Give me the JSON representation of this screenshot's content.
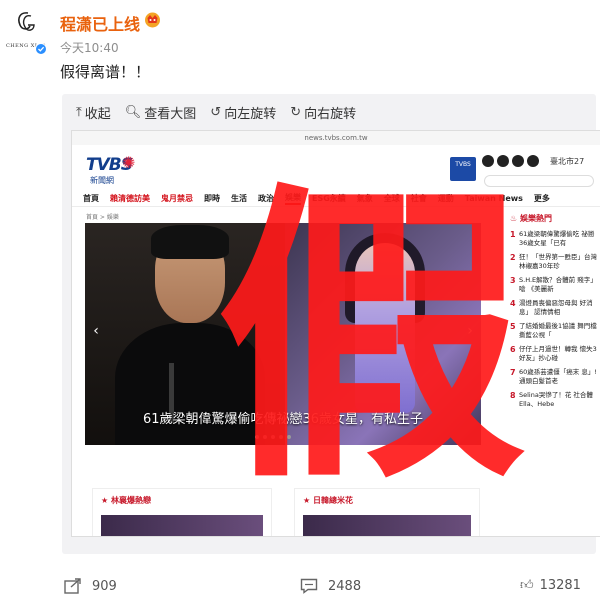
{
  "post": {
    "author": "程潇已上线",
    "avatar_text": "CHENG XIAO",
    "time": "今天10:40",
    "text": "假得离谱！！"
  },
  "viewer": {
    "toolbar": [
      {
        "icon": "collapse-icon",
        "label": "收起"
      },
      {
        "icon": "zoom-icon",
        "label": "查看大图"
      },
      {
        "icon": "rotate-left-icon",
        "label": "向左旋转"
      },
      {
        "icon": "rotate-right-icon",
        "label": "向右旋转"
      }
    ]
  },
  "screenshot": {
    "url": "news.tvbs.com.tw",
    "brand": "TVBS",
    "brand_sub": "新聞網",
    "city": "臺北市27",
    "nav": [
      "首頁",
      "賴清德訪美",
      "鬼月禁忌",
      "即時",
      "生活",
      "政治",
      "娛樂",
      "ESG永續",
      "氣象",
      "全球",
      "社會",
      "運動",
      "Taiwan News",
      "更多"
    ],
    "breadcrumb": "首頁 > 娛樂",
    "caption": "61歲梁朝偉驚爆偷吃傳祕戀36歲女星，有私生子",
    "hot_title": "娛樂熱門",
    "hot_items": [
      "61歲梁朝偉驚爆偷吃 祕戀36歲女星「已有",
      "狂！「世界第一甦臣」台灣 林襯嘉30年珍",
      "S.H.E解散？合體前 賤字」 嗆 《美麗新",
      "湯燈員喪偏惡怨母與 好消息」 認情情相",
      "了結婚婚最後1協議 舞門檔 撕藍公視「",
      "仔仔上月過世！轉我 懷失3好友」抄心碰",
      "60歲孫芸遭僵「癌末 息」!通頭白髮首老",
      "Selina哭慘了！花 社合體Ella、Hebe"
    ],
    "cards": [
      "林襄爆熱戀",
      "日韓總米花"
    ],
    "overlay_char": "假"
  },
  "footer": {
    "shares": "909",
    "comments": "2488",
    "likes": "13281"
  }
}
